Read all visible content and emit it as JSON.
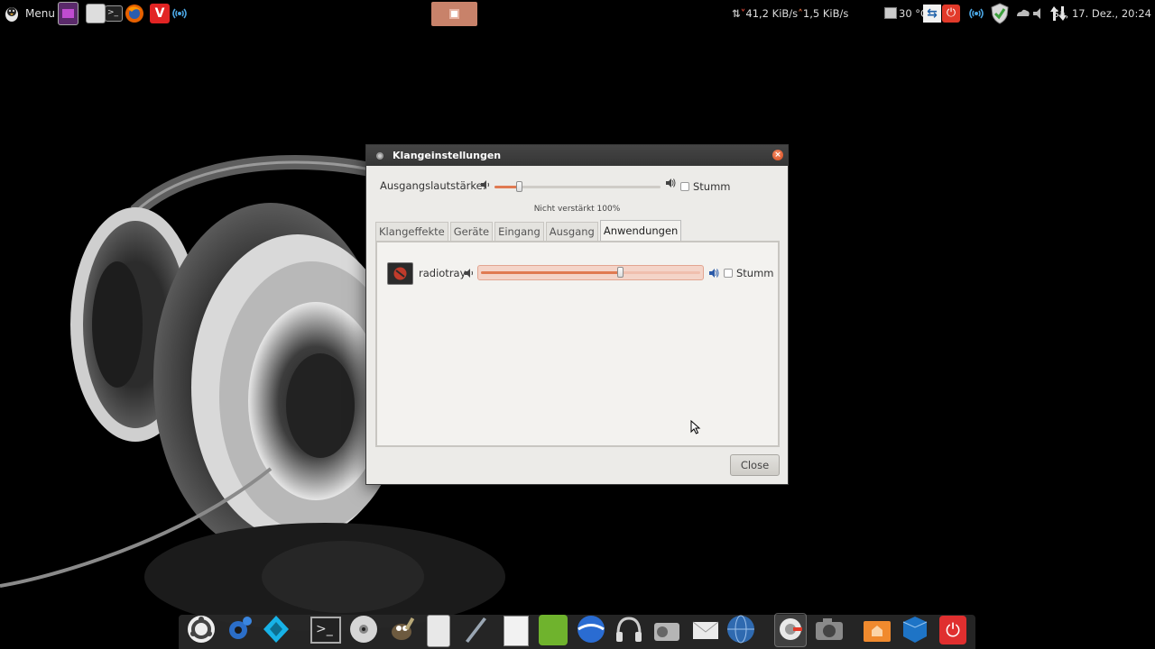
{
  "top_panel": {
    "menu_label": "Menu",
    "net_down": "41,2 KiB/s",
    "net_up": "1,5 KiB/s",
    "temperature": "30 °C",
    "clock": "Sa, 17. Dez., 20:24"
  },
  "dialog": {
    "title": "Klangeinstellungen",
    "output_volume_label": "Ausgangslautstärke:",
    "output_volume_percent": 0.16,
    "mute_label": "Stumm",
    "amplification_text": "Nicht verstärkt 100%",
    "tabs": [
      {
        "label": "Klangeffekte"
      },
      {
        "label": "Geräte"
      },
      {
        "label": "Eingang"
      },
      {
        "label": "Ausgang"
      },
      {
        "label": "Anwendungen"
      }
    ],
    "active_tab": "Anwendungen",
    "applications": [
      {
        "name": "radiotray",
        "volume": 0.64,
        "mute_label": "Stumm"
      }
    ],
    "close_label": "Close"
  },
  "colors": {
    "accent": "#e07a52",
    "panel_bg": "#000000",
    "dialog_bg": "#ecebe8",
    "titlebar": "#3d3d3d"
  },
  "dock_icons": [
    "ubuntu-logo-icon",
    "settings-gear-icon",
    "kodi-icon",
    "terminal-icon",
    "disc-icon",
    "gimp-icon",
    "calculator-icon",
    "pen-icon",
    "text-editor-icon",
    "archive-icon",
    "google-earth-icon",
    "headphones-icon",
    "radio-icon",
    "mail-icon",
    "globe-icon",
    "sound-settings-icon",
    "screenshot-camera-icon",
    "home-folder-icon",
    "virtualbox-icon",
    "shutdown-icon"
  ]
}
